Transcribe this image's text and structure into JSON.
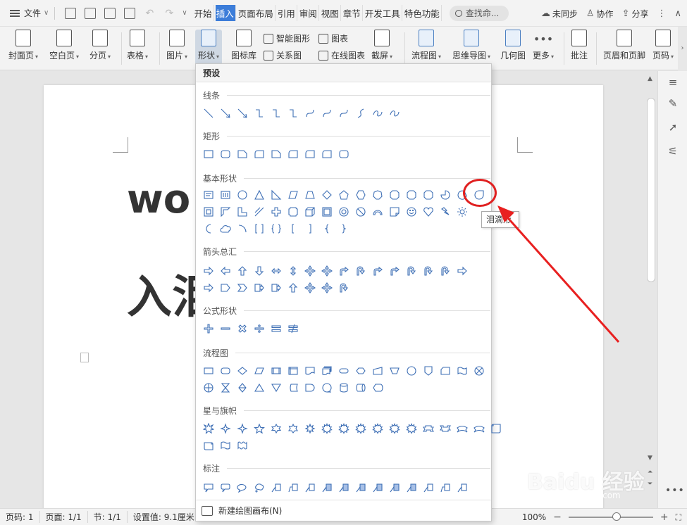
{
  "menubar": {
    "file_label": "文件",
    "tabs": [
      "开始",
      "插入",
      "页面布局",
      "引用",
      "审阅",
      "视图",
      "章节",
      "开发工具",
      "特色功能"
    ],
    "active_tab": "插入",
    "search_label": "查找命...",
    "sync_label": "未同步",
    "collab_label": "协作",
    "share_label": "分享"
  },
  "ribbon": {
    "cover_label": "封面页",
    "blank_label": "空白页",
    "pagebreak_label": "分页",
    "table_label": "表格",
    "picture_label": "图片",
    "shape_label": "形状",
    "iconlib_label": "图标库",
    "smartart_label": "智能图形",
    "chart_label": "图表",
    "relation_label": "关系图",
    "onlinechart_label": "在线图表",
    "screenshot_label": "截屏",
    "flowchart_label": "流程图",
    "mindmap_label": "思维导图",
    "geometry_label": "几何图",
    "more_label": "更多",
    "comment_label": "批注",
    "headerfooter_label": "页眉和页脚",
    "pagenum_label": "页码"
  },
  "document": {
    "line1": "wo",
    "line2": "入泪"
  },
  "dropdown": {
    "header": "预设",
    "sections": {
      "lines": "线条",
      "rect": "矩形",
      "basic": "基本形状",
      "arrows": "箭头总汇",
      "formula": "公式形状",
      "flow": "流程图",
      "stars": "星与旗帜",
      "callout": "标注"
    },
    "footer": "新建绘图画布(N)"
  },
  "tooltip": {
    "text": "泪滴形"
  },
  "statusbar": {
    "page": "页码: 1",
    "pages": "页面: 1/1",
    "section": "节: 1/1",
    "setting": "设置值: 9.1厘米",
    "zoom": "100%"
  },
  "watermark": {
    "text": "Baidu 经验",
    "sub": "jingyan.baidu.com"
  },
  "colors": {
    "accent": "#3c7dd9",
    "shape_stroke": "#3e6fb5",
    "annotation_red": "#e02020"
  }
}
